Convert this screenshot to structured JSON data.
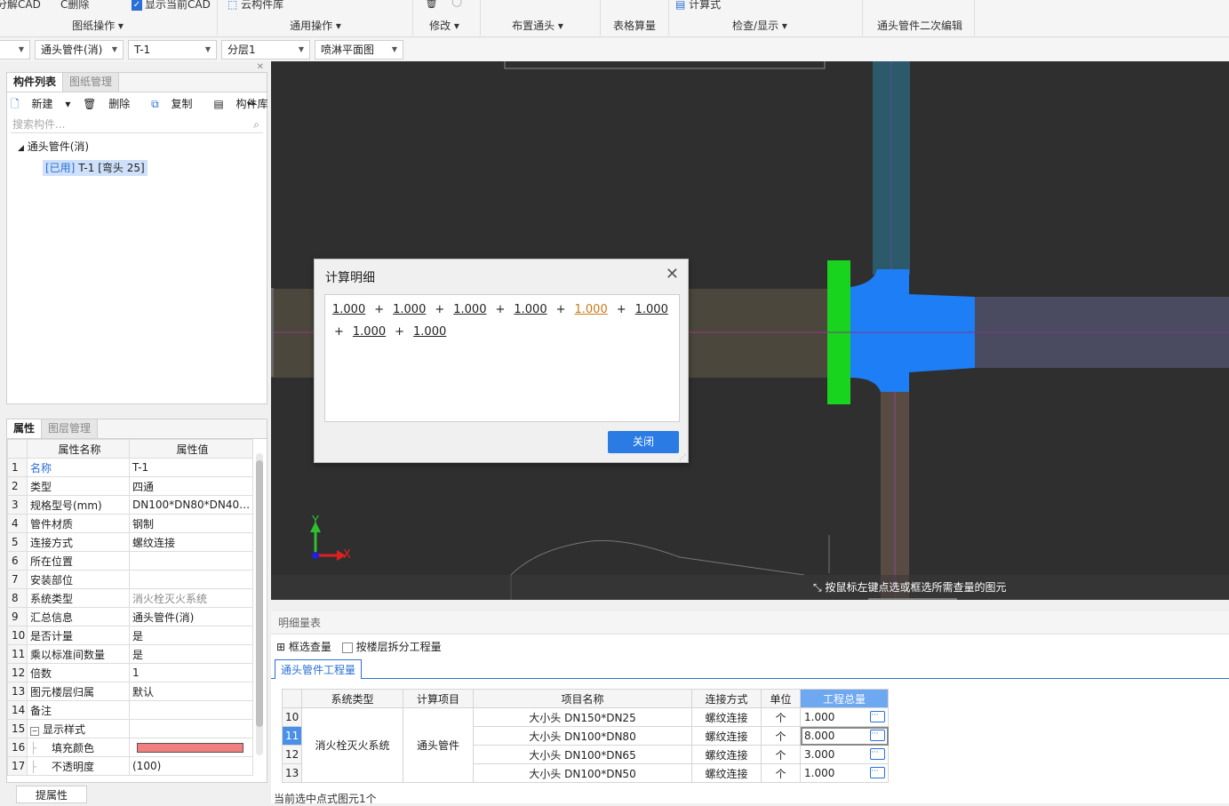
{
  "ribbon": {
    "top_items": [
      "分解CAD",
      "C删除",
      "显示当前CAD",
      "云构件库",
      "计算式"
    ],
    "groups": [
      "图纸操作",
      "通用操作",
      "修改",
      "布置通头",
      "表格算量",
      "检查/显示",
      "通头管件二次编辑"
    ]
  },
  "selectors": [
    "",
    "通头管件(消)",
    "T-1",
    "分层1",
    "喷淋平面图"
  ],
  "component_panel": {
    "tabs": [
      "构件列表",
      "图纸管理"
    ],
    "toolbar": [
      "新建",
      "删除",
      "复制",
      "构件库"
    ],
    "search_placeholder": "搜索构件...",
    "tree_root": "通头管件(消)",
    "tree_item_tag": "[已用]",
    "tree_item_label": "T-1 [弯头 25]"
  },
  "property_panel": {
    "tabs": [
      "属性",
      "图层管理"
    ],
    "headers": [
      "属性名称",
      "属性值"
    ],
    "rows": [
      {
        "n": "1",
        "name": "名称",
        "value": "T-1"
      },
      {
        "n": "2",
        "name": "类型",
        "value": "四通"
      },
      {
        "n": "3",
        "name": "规格型号(mm)",
        "value": "DN100*DN80*DN40*..."
      },
      {
        "n": "4",
        "name": "管件材质",
        "value": "钢制"
      },
      {
        "n": "5",
        "name": "连接方式",
        "value": "螺纹连接"
      },
      {
        "n": "6",
        "name": "所在位置",
        "value": ""
      },
      {
        "n": "7",
        "name": "安装部位",
        "value": ""
      },
      {
        "n": "8",
        "name": "系统类型",
        "value": "消火栓灭火系统"
      },
      {
        "n": "9",
        "name": "汇总信息",
        "value": "通头管件(消)"
      },
      {
        "n": "10",
        "name": "是否计量",
        "value": "是"
      },
      {
        "n": "11",
        "name": "乘以标准间数量",
        "value": "是"
      },
      {
        "n": "12",
        "name": "倍数",
        "value": "1"
      },
      {
        "n": "13",
        "name": "图元楼层归属",
        "value": "默认"
      },
      {
        "n": "14",
        "name": "备注",
        "value": ""
      },
      {
        "n": "15",
        "name": "显示样式",
        "value": ""
      },
      {
        "n": "16",
        "name": "填充颜色",
        "value": ""
      },
      {
        "n": "17",
        "name": "不透明度",
        "value": "(100)"
      }
    ],
    "fill_color": "#f08080",
    "footer_button": "提属性"
  },
  "canvas": {
    "hint": "按鼠标左键点选或框选所需查量的图元",
    "axis_y": "Y",
    "axis_x": "X"
  },
  "dialog": {
    "title": "计算明细",
    "values": [
      "1.000",
      "1.000",
      "1.000",
      "1.000",
      "1.000",
      "1.000",
      "1.000",
      "1.000"
    ],
    "operator": "+",
    "close_button": "关闭"
  },
  "bottom_panel": {
    "title": "明细量表",
    "box_select": "框选查量",
    "split_by_floor": "按楼层拆分工程量",
    "tab": "通头管件工程量",
    "headers": [
      "系统类型",
      "计算项目",
      "项目名称",
      "连接方式",
      "单位",
      "工程总量"
    ],
    "system_type": "消火栓灭火系统",
    "calc_item": "通头管件",
    "rows": [
      {
        "n": "10",
        "name": "大小头 DN150*DN25",
        "conn": "螺纹连接",
        "unit": "个",
        "qty": "1.000"
      },
      {
        "n": "11",
        "name": "大小头 DN100*DN80",
        "conn": "螺纹连接",
        "unit": "个",
        "qty": "8.000"
      },
      {
        "n": "12",
        "name": "大小头 DN100*DN65",
        "conn": "螺纹连接",
        "unit": "个",
        "qty": "3.000"
      },
      {
        "n": "13",
        "name": "大小头 DN100*DN50",
        "conn": "螺纹连接",
        "unit": "个",
        "qty": "1.000"
      }
    ]
  },
  "status_bar": "当前选中点式图元1个"
}
